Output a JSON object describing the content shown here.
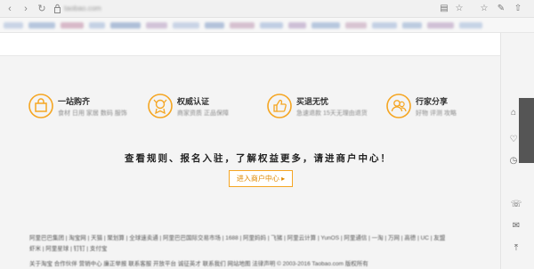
{
  "browser": {
    "url": "taobao.com",
    "colors": {
      "chrome_bg": "#f1f1f1"
    }
  },
  "bookmarks": [
    {
      "color": "#c9d4e6",
      "w": 22
    },
    {
      "color": "#b6c6dd",
      "w": 30
    },
    {
      "color": "#d7b9c8",
      "w": 26
    },
    {
      "color": "#c4d1e4",
      "w": 18
    },
    {
      "color": "#aebfd8",
      "w": 34
    },
    {
      "color": "#d2c3d8",
      "w": 24
    },
    {
      "color": "#c9d4e6",
      "w": 30
    },
    {
      "color": "#b2c2da",
      "w": 22
    },
    {
      "color": "#d5c0cf",
      "w": 28
    },
    {
      "color": "#c0cee3",
      "w": 26
    },
    {
      "color": "#cdbfd6",
      "w": 20
    },
    {
      "color": "#b7c7de",
      "w": 32
    },
    {
      "color": "#d8c4d2",
      "w": 24
    },
    {
      "color": "#c3d0e4",
      "w": 28
    },
    {
      "color": "#bccbe0",
      "w": 22
    },
    {
      "color": "#d0c0d5",
      "w": 30
    },
    {
      "color": "#c6d3e6",
      "w": 26
    }
  ],
  "features": [
    {
      "title": "一站购齐",
      "subtitle": "食材 日用 家居 数码 服饰",
      "icon": "bag-icon"
    },
    {
      "title": "权威认证",
      "subtitle": "商家资质 正品保障",
      "icon": "badge-icon"
    },
    {
      "title": "买退无忧",
      "subtitle": "急速退款 15天无理由退货",
      "icon": "thumbs-up-icon"
    },
    {
      "title": "行家分享",
      "subtitle": "好物 评测 攻略",
      "icon": "people-icon"
    }
  ],
  "slogan": "查看规则、报名入驻，了解权益更多，请进商户中心！",
  "cta": "进入商户中心 ▸",
  "footer": {
    "line1": "阿里巴巴集团 | 淘宝网 | 天猫 | 聚划算 | 全球速卖通 | 阿里巴巴国际交易市场 | 1688 | 阿里妈妈 | 飞猪 | 阿里云计算 | YunOS | 阿里通信 | 一淘 | 万网 | 高德 | UC | 友盟",
    "line2": "虾米 | 阿里星球 | 钉钉 | 支付宝",
    "line3": "关于淘宝 合作伙伴 营销中心 廉正举报 联系客服 开放平台 诚征英才 联系我们 网站地图 法律声明     © 2003-2016 Taobao.com 版权所有"
  },
  "colors": {
    "accent": "#f5a623",
    "accent_text": "#e08a00"
  }
}
